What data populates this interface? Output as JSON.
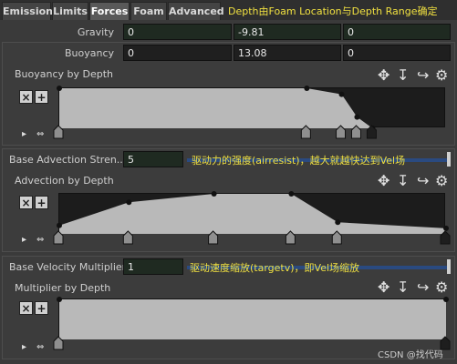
{
  "tabs": [
    "Emission",
    "Limits",
    "Forces",
    "Foam",
    "Advanced"
  ],
  "active_tab": "Forces",
  "tab_annotation": "Depth由Foam Location与Depth Range确定",
  "gravity": {
    "label": "Gravity",
    "values": [
      "0",
      "-9.81",
      "0"
    ]
  },
  "buoyancy": {
    "label": "Buoyancy",
    "values": [
      "0",
      "13.08",
      "0"
    ]
  },
  "buoyancy_ramp": {
    "title": "Buoyancy by Depth",
    "points": [
      [
        0.0,
        0.0
      ],
      [
        0.64,
        0.0
      ],
      [
        0.73,
        0.15
      ],
      [
        0.77,
        0.72
      ],
      [
        0.81,
        1.0
      ]
    ]
  },
  "advection": {
    "label": "Base Advection Stren...",
    "value": "5",
    "annotation": "驱动力的强度(airresist)，越大就越快达到Vel场",
    "slider_fraction": 1.0
  },
  "advection_ramp": {
    "title": "Advection by Depth",
    "points": [
      [
        0.0,
        0.79
      ],
      [
        0.18,
        0.21
      ],
      [
        0.4,
        0.0
      ],
      [
        0.6,
        0.0
      ],
      [
        0.72,
        0.71
      ],
      [
        1.0,
        0.86
      ]
    ]
  },
  "velocity": {
    "label": "Base Velocity Multiplier",
    "value": "1",
    "annotation": "驱动速度缩放(targetv)，即Vel场缩放",
    "slider_fraction": 1.0
  },
  "velocity_ramp": {
    "title": "Multiplier by Depth",
    "points": [
      [
        0.0,
        0.0
      ],
      [
        1.0,
        0.0
      ]
    ]
  },
  "icons": {
    "move": "✥",
    "arrow": "↧",
    "curve": "↪",
    "gear": "⚙",
    "close": "×",
    "add": "+",
    "play": "▸",
    "expand": "⇔"
  },
  "watermark": "CSDN @找代码",
  "colors": {
    "accent": "#f0e040",
    "ramp_fill": "#b9b9b9",
    "slider": "#2a4a80"
  }
}
